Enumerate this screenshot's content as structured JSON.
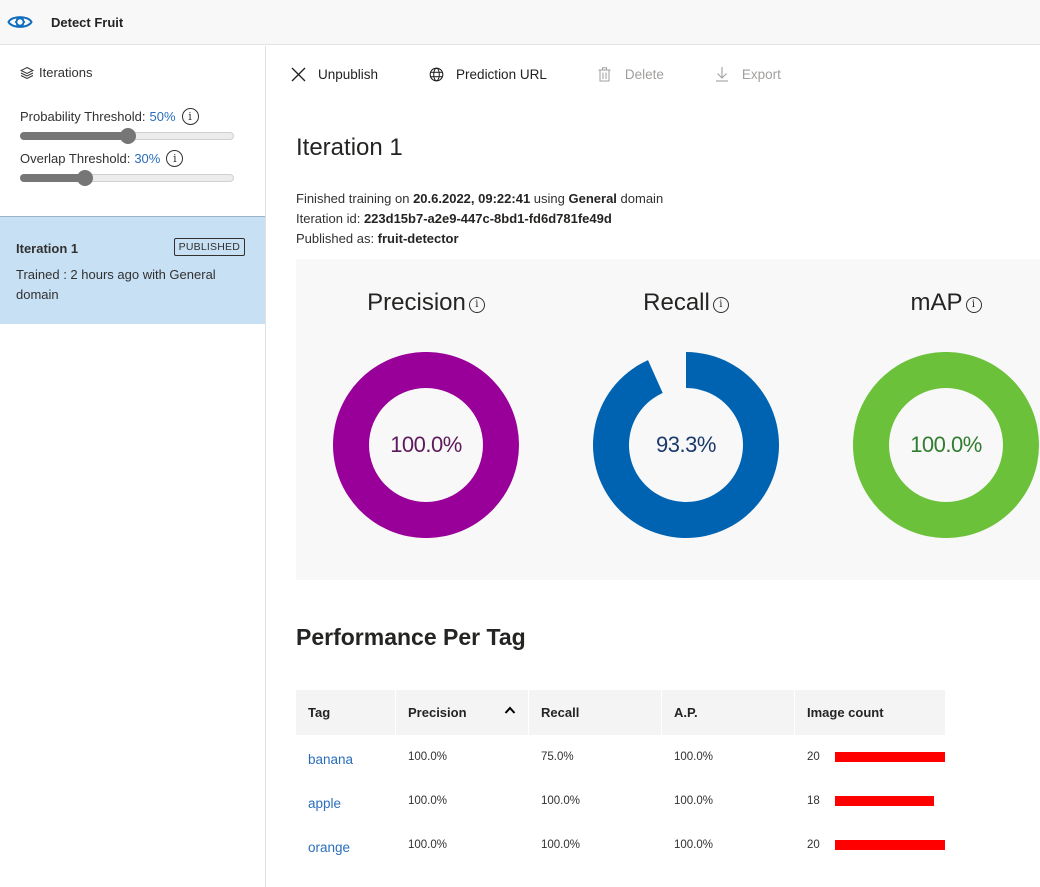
{
  "app": {
    "title": "Detect Fruit",
    "logo_icon": "eye-gear-icon"
  },
  "sidebar": {
    "heading": "Iterations",
    "heading_icon": "layers-icon",
    "probability_threshold": {
      "label": "Probability Threshold:",
      "value": "50%",
      "percent": 50
    },
    "overlap_threshold": {
      "label": "Overlap Threshold:",
      "value": "30%",
      "percent": 30
    },
    "info_glyph": "i",
    "iterations": [
      {
        "name": "Iteration 1",
        "badge": "PUBLISHED",
        "description": "Trained : 2 hours ago with General domain",
        "selected": true
      }
    ]
  },
  "toolbar": {
    "unpublish": "Unpublish",
    "prediction_url": "Prediction URL",
    "delete": "Delete",
    "export": "Export"
  },
  "iteration": {
    "title": "Iteration 1",
    "finished_prefix": "Finished training on ",
    "finished_date": "20.6.2022, 09:22:41",
    "using": " using ",
    "domain": "General",
    "domain_suffix": " domain",
    "id_label": "Iteration id: ",
    "id": "223d15b7-a2e9-447c-8bd1-fd6d781fe49d",
    "published_label": "Published as: ",
    "published_name": "fruit-detector"
  },
  "metrics": [
    {
      "label": "Precision",
      "value_text": "100.0%",
      "value": 100.0,
      "color": "#990099",
      "text_color": "#5c1a5c"
    },
    {
      "label": "Recall",
      "value_text": "93.3%",
      "value": 93.3,
      "color": "#0063b1",
      "text_color": "#1b3a6b"
    },
    {
      "label": "mAP",
      "value_text": "100.0%",
      "value": 100.0,
      "color": "#6bc23a",
      "text_color": "#2f7d2f"
    }
  ],
  "performance": {
    "title": "Performance Per Tag",
    "columns": [
      "Tag",
      "Precision",
      "Recall",
      "A.P.",
      "Image count"
    ],
    "sort_column": "Precision",
    "sort_glyph": "^",
    "bar_color": "#ff0000",
    "max_count": 20,
    "rows": [
      {
        "tag": "banana",
        "precision": "100.0%",
        "recall": "75.0%",
        "ap": "100.0%",
        "count": 20
      },
      {
        "tag": "apple",
        "precision": "100.0%",
        "recall": "100.0%",
        "ap": "100.0%",
        "count": 18
      },
      {
        "tag": "orange",
        "precision": "100.0%",
        "recall": "100.0%",
        "ap": "100.0%",
        "count": 20
      }
    ]
  }
}
